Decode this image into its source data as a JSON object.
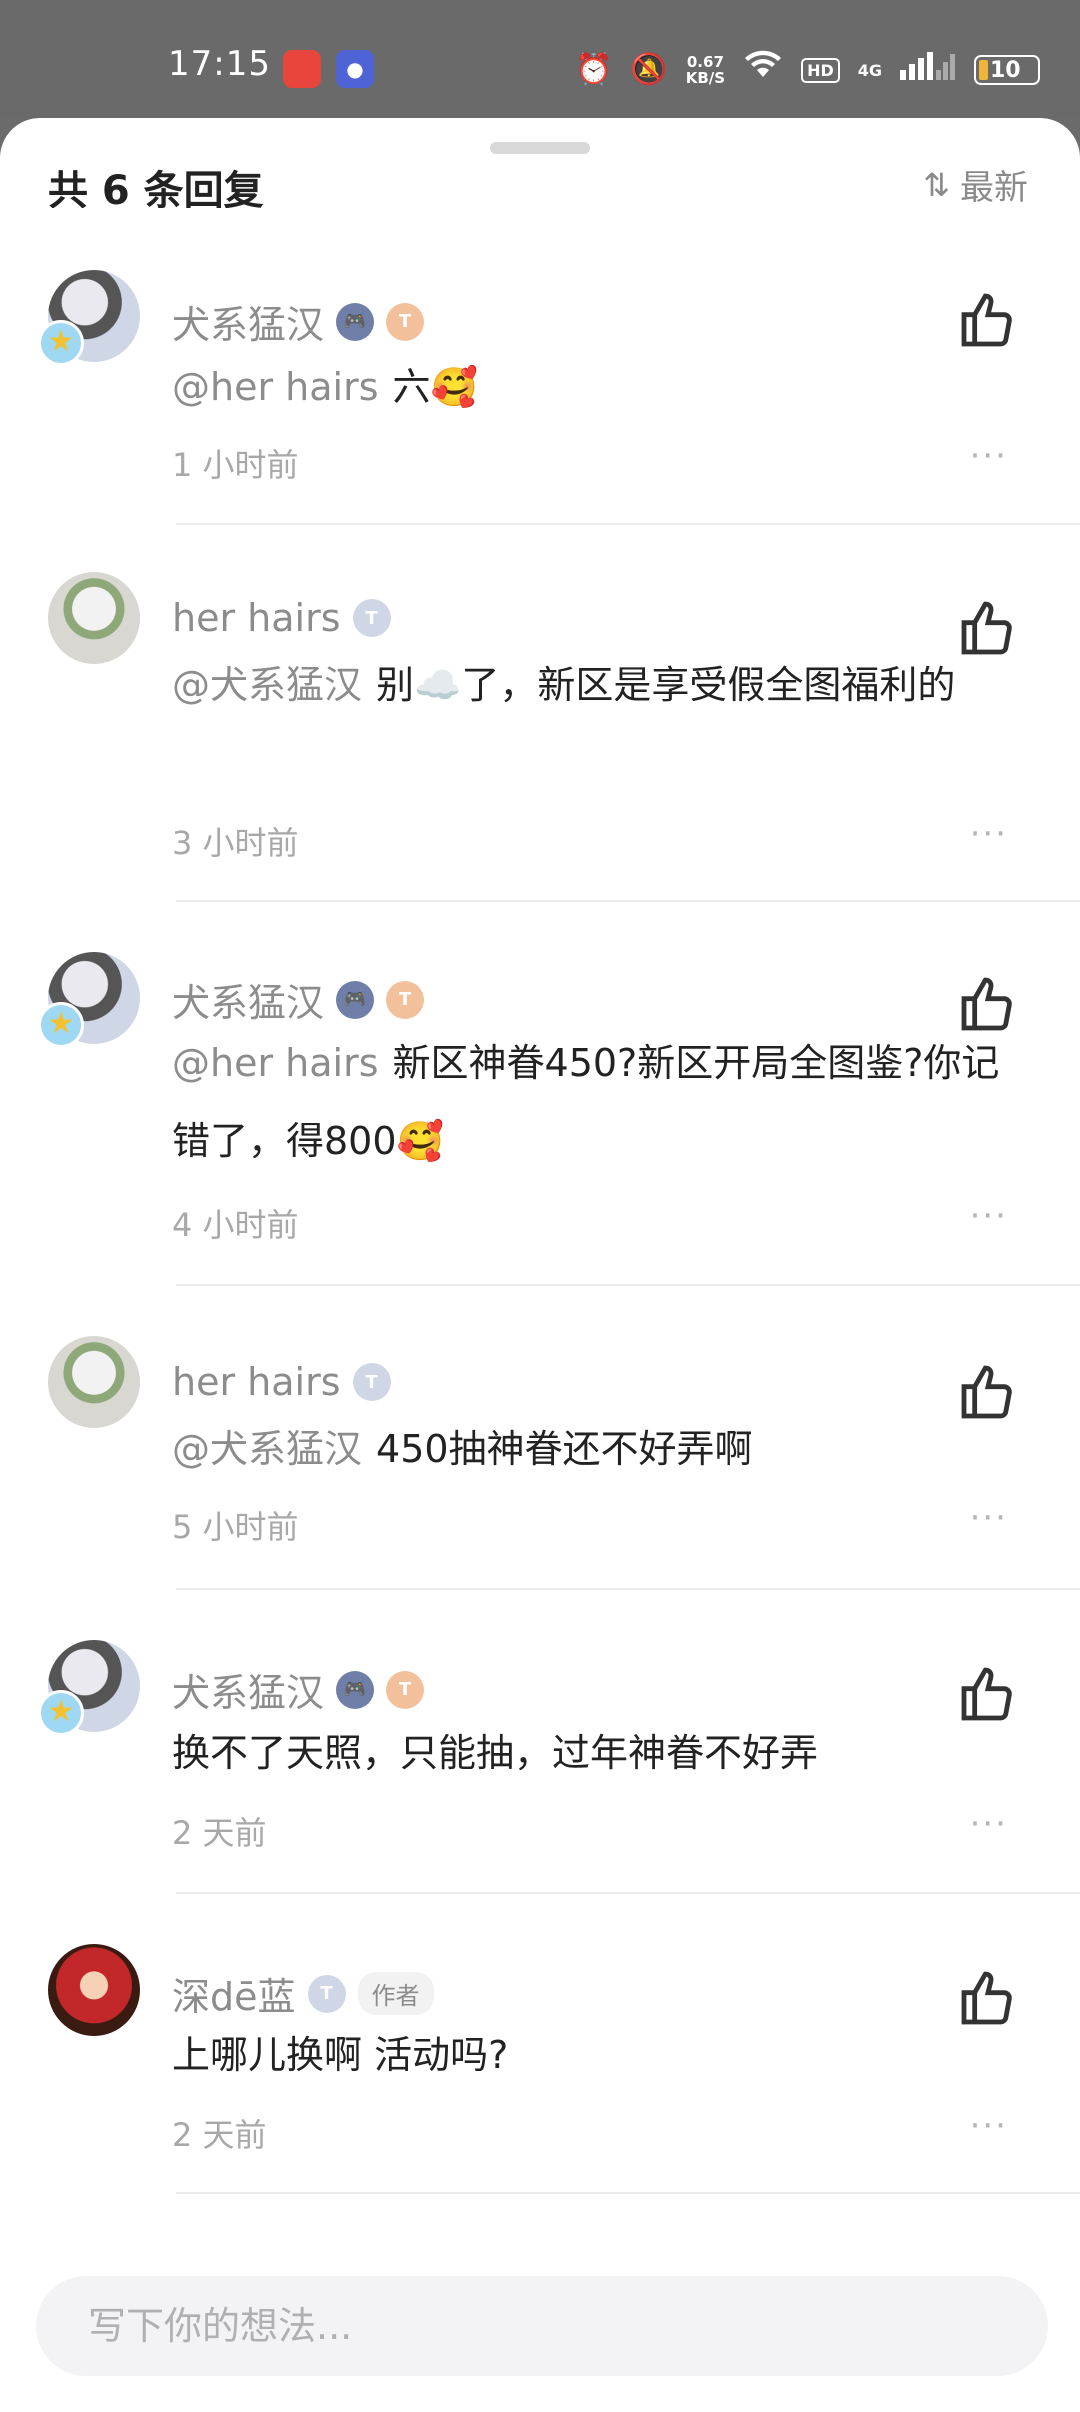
{
  "status_bar": {
    "time": "17:15",
    "net_speed_value": "0.67",
    "net_speed_unit": "KB/S",
    "hd_label": "HD",
    "network_type": "4G",
    "battery_level": "10",
    "icons": [
      "music-app-icon",
      "tieba-app-icon",
      "alarm-icon",
      "mute-icon",
      "wifi-icon",
      "signal-icon",
      "battery-icon"
    ]
  },
  "header": {
    "reply_count": "共 6 条回复",
    "sort_label": "最新"
  },
  "comments": [
    {
      "username": "犬系猛汉",
      "badges": [
        "game",
        "T5"
      ],
      "mention": "@her hairs",
      "text": "六🥰",
      "time": "1 小时前"
    },
    {
      "username": "her hairs",
      "badges": [
        "T1"
      ],
      "mention": "@犬系猛汉",
      "text": "别☁️了，新区是享受假全图福利的",
      "time": "3 小时前"
    },
    {
      "username": "犬系猛汉",
      "badges": [
        "game",
        "T5"
      ],
      "mention": "@her hairs",
      "text": "新区神眷450?新区开局全图鉴?你记错了，得800🥰",
      "time": "4 小时前"
    },
    {
      "username": "her hairs",
      "badges": [
        "T1"
      ],
      "mention": "@犬系猛汉",
      "text": "450抽神眷还不好弄啊",
      "time": "5 小时前"
    },
    {
      "username": "犬系猛汉",
      "badges": [
        "game",
        "T5"
      ],
      "mention": "",
      "text": "换不了天照，只能抽，过年神眷不好弄",
      "time": "2 天前"
    },
    {
      "username": "深dē蓝",
      "badges": [
        "T1"
      ],
      "author_tag": "作者",
      "mention": "",
      "text": "上哪儿换啊 活动吗?",
      "time": "2 天前"
    }
  ],
  "badge_labels": {
    "game": "🎮",
    "t5": "T",
    "t1": "T"
  },
  "more_label": "···",
  "input": {
    "placeholder": "写下你的想法..."
  },
  "colors": {
    "mention": "#8c8c8c",
    "text": "#222222",
    "time": "#a8a8a8"
  }
}
